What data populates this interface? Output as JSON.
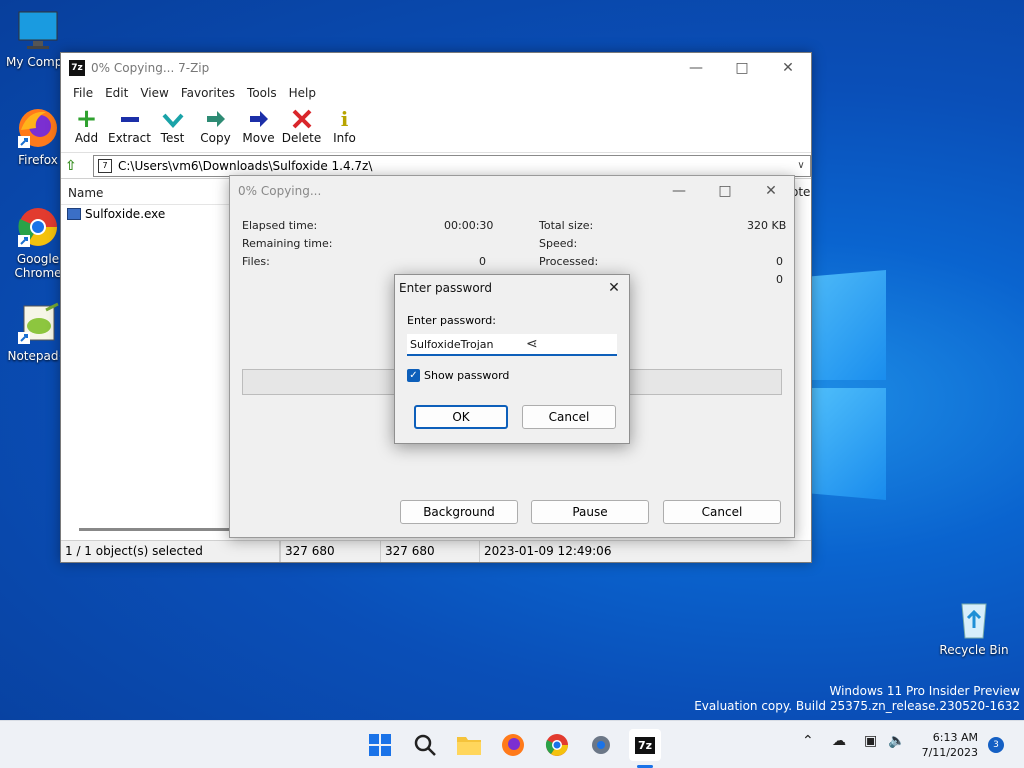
{
  "desktop": {
    "icons": [
      {
        "label": "My Compu"
      },
      {
        "label": "Firefox"
      },
      {
        "label": "Google Chrome"
      },
      {
        "label": "Notepad+"
      },
      {
        "label": "Recycle Bin"
      }
    ],
    "watermark": {
      "line1": "Windows 11 Pro Insider Preview",
      "line2": "Evaluation copy. Build 25375.zn_release.230520-1632"
    }
  },
  "main_window": {
    "title": "0% Copying... 7-Zip",
    "app_icon": "7z",
    "menu": [
      "File",
      "Edit",
      "View",
      "Favorites",
      "Tools",
      "Help"
    ],
    "toolbar": [
      {
        "label": "Add",
        "icon": "plus-icon"
      },
      {
        "label": "Extract",
        "icon": "minus-icon"
      },
      {
        "label": "Test",
        "icon": "check-icon"
      },
      {
        "label": "Copy",
        "icon": "copy-arrow-icon"
      },
      {
        "label": "Move",
        "icon": "move-arrow-icon"
      },
      {
        "label": "Delete",
        "icon": "x-icon"
      },
      {
        "label": "Info",
        "icon": "info-icon"
      }
    ],
    "address": "C:\\Users\\vm6\\Downloads\\Sulfoxide 1.4.7z\\",
    "column_name": "Name",
    "column_partial": "ote",
    "files": [
      {
        "name": "Sulfoxide.exe"
      }
    ],
    "status": {
      "selected": "1 / 1 object(s) selected",
      "size": "327 680",
      "packed": "327 680",
      "modified": "2023-01-09 12:49:06"
    }
  },
  "copy_dialog": {
    "title": "0% Copying...",
    "elapsed_label": "Elapsed time:",
    "elapsed_value": "00:00:30",
    "remaining_label": "Remaining time:",
    "files_label": "Files:",
    "files_value": "0",
    "total_size_label": "Total size:",
    "total_size_value": "320 KB",
    "speed_label": "Speed:",
    "processed_label": "Processed:",
    "processed_value": "0",
    "extra_value": "0",
    "progress": 0,
    "buttons": {
      "background": "Background",
      "pause": "Pause",
      "cancel": "Cancel"
    }
  },
  "password_dialog": {
    "title": "Enter password",
    "label": "Enter password:",
    "value": "SulfoxideTrojan",
    "show_password_label": "Show password",
    "show_password_checked": true,
    "ok": "OK",
    "cancel": "Cancel"
  },
  "taskbar": {
    "time": "6:13 AM",
    "date": "7/11/2023",
    "notification_count": "3"
  },
  "colors": {
    "accent": "#0d5fba",
    "desktop": "#0a64cf",
    "add_green": "#2fa12f",
    "delete_red": "#d9262b"
  }
}
